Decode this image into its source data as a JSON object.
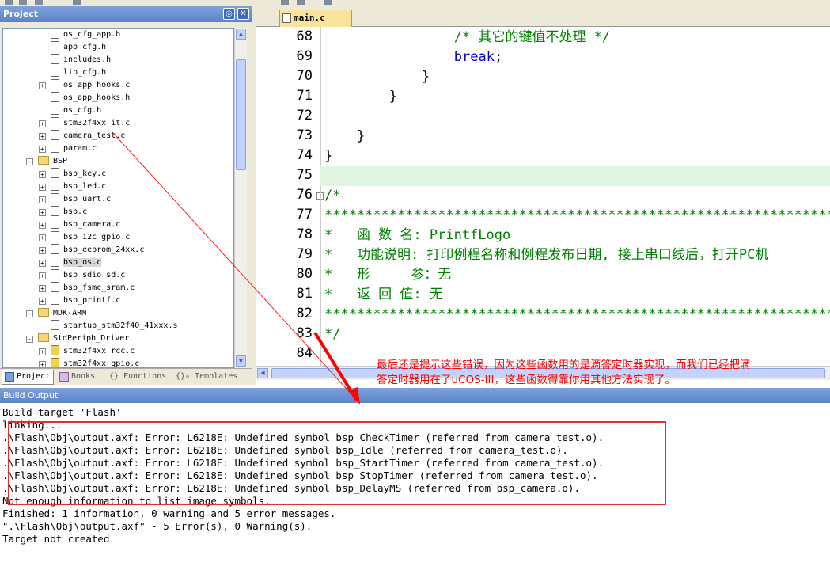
{
  "project_panel": {
    "title": "Project",
    "tree": [
      {
        "label": "os_cfg_app.h",
        "icon": "file-icon",
        "expander": ""
      },
      {
        "label": "app_cfg.h",
        "icon": "file-icon",
        "expander": ""
      },
      {
        "label": "includes.h",
        "icon": "file-icon",
        "expander": ""
      },
      {
        "label": "lib_cfg.h",
        "icon": "file-icon",
        "expander": ""
      },
      {
        "label": "os_app_hooks.c",
        "icon": "file-icon",
        "expander": "+"
      },
      {
        "label": "os_app_hooks.h",
        "icon": "file-icon",
        "expander": ""
      },
      {
        "label": "os_cfg.h",
        "icon": "file-icon",
        "expander": ""
      },
      {
        "label": "stm32f4xx_it.c",
        "icon": "file-icon",
        "expander": "+"
      },
      {
        "label": "camera_test.c",
        "icon": "file-icon",
        "expander": "+"
      },
      {
        "label": "param.c",
        "icon": "file-icon",
        "expander": "+"
      },
      {
        "label": "BSP",
        "icon": "folder-icon",
        "expander": "-"
      },
      {
        "label": "bsp_key.c",
        "icon": "file-icon",
        "expander": "+"
      },
      {
        "label": "bsp_led.c",
        "icon": "file-icon",
        "expander": "+"
      },
      {
        "label": "bsp_uart.c",
        "icon": "file-icon",
        "expander": "+"
      },
      {
        "label": "bsp.c",
        "icon": "file-icon",
        "expander": "+"
      },
      {
        "label": "bsp_camera.c",
        "icon": "file-icon",
        "expander": "+"
      },
      {
        "label": "bsp_i2c_gpio.c",
        "icon": "file-icon",
        "expander": "+"
      },
      {
        "label": "bsp_eeprom_24xx.c",
        "icon": "file-icon",
        "expander": "+"
      },
      {
        "label": "bsp_os.c",
        "icon": "file-icon",
        "expander": "+"
      },
      {
        "label": "bsp_sdio_sd.c",
        "icon": "file-icon",
        "expander": "+"
      },
      {
        "label": "bsp_fsmc_sram.c",
        "icon": "file-icon",
        "expander": "+"
      },
      {
        "label": "bsp_printf.c",
        "icon": "file-icon",
        "expander": "+"
      },
      {
        "label": "MDK-ARM",
        "icon": "folder-icon",
        "expander": "-"
      },
      {
        "label": "startup_stm32f40_41xxx.s",
        "icon": "file-icon",
        "expander": ""
      },
      {
        "label": "StdPeriph_Driver",
        "icon": "folder-icon",
        "expander": "-"
      },
      {
        "label": "stm32f4xx_rcc.c",
        "icon": "chip-file-icon",
        "expander": "+"
      },
      {
        "label": "stm32f4xx_gpio.c",
        "icon": "chip-file-icon",
        "expander": "+"
      }
    ],
    "tabs": [
      "Project",
      "Books",
      "{} Functions",
      "{}₀ Templates"
    ]
  },
  "editor": {
    "file_tab": "main.c",
    "lines": [
      {
        "no": "68",
        "fold": "",
        "segments": [
          {
            "t": "                /* 其它的键值不处理 */",
            "c": "comment"
          }
        ]
      },
      {
        "no": "69",
        "fold": "",
        "segments": [
          {
            "t": "                break",
            "c": "keyword"
          },
          {
            "t": ";",
            "c": "plain"
          }
        ]
      },
      {
        "no": "70",
        "fold": "",
        "segments": [
          {
            "t": "            }",
            "c": "plain"
          }
        ]
      },
      {
        "no": "71",
        "fold": "",
        "segments": [
          {
            "t": "        }",
            "c": "plain"
          }
        ]
      },
      {
        "no": "72",
        "fold": "",
        "segments": [
          {
            "t": "",
            "c": "plain"
          }
        ]
      },
      {
        "no": "73",
        "fold": "",
        "segments": [
          {
            "t": "    }",
            "c": "plain"
          }
        ]
      },
      {
        "no": "74",
        "fold": "",
        "segments": [
          {
            "t": "}",
            "c": "plain"
          }
        ]
      },
      {
        "no": "75",
        "fold": "",
        "segments": [
          {
            "t": "",
            "c": "plain"
          }
        ]
      },
      {
        "no": "76",
        "fold": "−",
        "segments": [
          {
            "t": "/*",
            "c": "comment"
          }
        ]
      },
      {
        "no": "77",
        "fold": "",
        "segments": [
          {
            "t": "*****************************************************************",
            "c": "comment"
          }
        ]
      },
      {
        "no": "78",
        "fold": "",
        "segments": [
          {
            "t": "*   函 数 名: PrintfLogo",
            "c": "comment"
          }
        ]
      },
      {
        "no": "79",
        "fold": "",
        "segments": [
          {
            "t": "*   功能说明: 打印例程名称和例程发布日期, 接上串口线后，打开PC机",
            "c": "comment"
          }
        ]
      },
      {
        "no": "80",
        "fold": "",
        "segments": [
          {
            "t": "*   形     参：无",
            "c": "comment"
          }
        ]
      },
      {
        "no": "81",
        "fold": "",
        "segments": [
          {
            "t": "*   返 回 值: 无",
            "c": "comment"
          }
        ]
      },
      {
        "no": "82",
        "fold": "",
        "segments": [
          {
            "t": "*****************************************************************",
            "c": "comment"
          }
        ]
      },
      {
        "no": "83",
        "fold": "",
        "segments": [
          {
            "t": "*/",
            "c": "comment"
          }
        ]
      },
      {
        "no": "84",
        "fold": "",
        "segments": [
          {
            "t": "",
            "c": "plain"
          }
        ]
      }
    ],
    "current_line": "75"
  },
  "annotation": {
    "line1": "最后还是提示这些错误，因为这些函数用的是滴答定时器实现，而我们已经把滴",
    "line2": "答定时器用在了uCOS-III，这些函数得靠你用其他方法实现了。",
    "color": "#ff0000"
  },
  "build_output": {
    "title": "Build Output",
    "lines": [
      "Build target 'Flash'",
      "linking...",
      ".\\Flash\\Obj\\output.axf: Error: L6218E: Undefined symbol bsp_CheckTimer (referred from camera_test.o).",
      ".\\Flash\\Obj\\output.axf: Error: L6218E: Undefined symbol bsp_Idle (referred from camera_test.o).",
      ".\\Flash\\Obj\\output.axf: Error: L6218E: Undefined symbol bsp_StartTimer (referred from camera_test.o).",
      ".\\Flash\\Obj\\output.axf: Error: L6218E: Undefined symbol bsp_StopTimer (referred from camera_test.o).",
      ".\\Flash\\Obj\\output.axf: Error: L6218E: Undefined symbol bsp_DelayMS (referred from bsp_camera.o).",
      "Not enough information to list image symbols.",
      "Finished: 1 information, 0 warning and 5 error messages.",
      "\".\\Flash\\Obj\\output.axf\" - 5 Error(s), 0 Warning(s).",
      "Target not created"
    ]
  },
  "colors": {
    "highlight_box": "#e03030",
    "comment": "#008000",
    "keyword": "#0000c0",
    "current_line_bg": "#e0f5e0"
  }
}
